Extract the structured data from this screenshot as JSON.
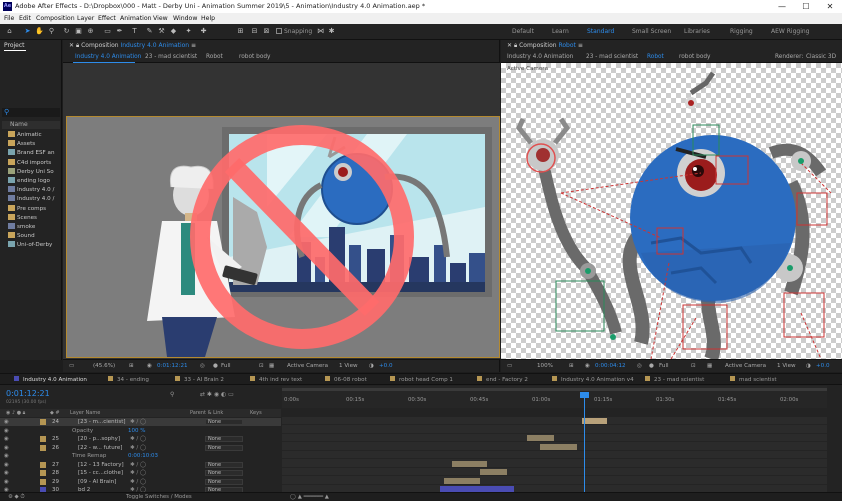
{
  "titlebar": {
    "app_logo": "Ae",
    "title": "Adobe After Effects - D:\\Dropbox\\000 - Matt - Derby Uni - Animation Summer 2019\\5 - Animation\\Industry 4.0 Animation.aep *",
    "minimize": "—",
    "maximize": "☐",
    "close": "✕"
  },
  "menubar": [
    "File",
    "Edit",
    "Composition",
    "Layer",
    "Effect",
    "Animation",
    "View",
    "Window",
    "Help"
  ],
  "toolbar": {
    "snapping": "Snapping",
    "workspaces": [
      {
        "label": "Default",
        "active": false
      },
      {
        "label": "Learn",
        "active": false
      },
      {
        "label": "Standard",
        "active": true
      },
      {
        "label": "Small Screen",
        "active": false
      },
      {
        "label": "Libraries",
        "active": false
      },
      {
        "label": "Rigging",
        "active": false
      },
      {
        "label": "AEW Rigging",
        "active": false
      }
    ]
  },
  "project": {
    "tab": "Project",
    "search_icon": "search-icon",
    "name_header": "Name",
    "items": [
      {
        "label": "Animatic",
        "kind": "folder"
      },
      {
        "label": "Assets",
        "kind": "folder"
      },
      {
        "label": "Brand ESF an",
        "kind": "img"
      },
      {
        "label": "C4d imports",
        "kind": "folder"
      },
      {
        "label": "Derby Uni So",
        "kind": "aud"
      },
      {
        "label": "ending logo",
        "kind": "img"
      },
      {
        "label": "Industry 4.0 /",
        "kind": "comp"
      },
      {
        "label": "Industry 4.0 /",
        "kind": "comp"
      },
      {
        "label": "Pre comps",
        "kind": "folder"
      },
      {
        "label": "Scenes",
        "kind": "folder"
      },
      {
        "label": "smoke",
        "kind": "comp"
      },
      {
        "label": "Sound",
        "kind": "folder"
      },
      {
        "label": "Uni-of-Derby",
        "kind": "img"
      }
    ]
  },
  "viewer_left": {
    "tab_prefix": "Composition",
    "tab_name": "Industry 4.0 Animation",
    "crumbs": [
      "Industry 4.0 Animation",
      "23 - mad scientist",
      "Robot",
      "robot body"
    ],
    "zoom": "(45.6%)",
    "timecode": "0:01:12:21",
    "quality": "Full",
    "camera": "Active Camera",
    "views": "1 View",
    "exposure": "+0.0"
  },
  "viewer_right": {
    "tab_prefix": "Composition",
    "tab_name": "Robot",
    "crumbs": [
      "Industry 4.0 Animation",
      "23 - mad scientist",
      "Robot",
      "robot body"
    ],
    "renderer_label": "Renderer:",
    "renderer": "Classic 3D",
    "active_camera": "Active Camera",
    "zoom": "100%",
    "timecode": "0:00:04:12",
    "quality": "Full",
    "camera": "Active Camera",
    "views": "1 View",
    "exposure": "+0.0"
  },
  "timeline": {
    "tabs": [
      {
        "label": "Industry 4.0 Animation",
        "active": true
      },
      {
        "label": "34 - ending",
        "active": false
      },
      {
        "label": "33 - AI Brain 2",
        "active": false
      },
      {
        "label": "4th ind rev text",
        "active": false
      },
      {
        "label": "06-08 robot",
        "active": false
      },
      {
        "label": "robot head Comp 1",
        "active": false
      },
      {
        "label": "end - Factory 2",
        "active": false
      },
      {
        "label": "Industry 4.0 Animation v4",
        "active": false
      },
      {
        "label": "23 - mad scientist",
        "active": false
      },
      {
        "label": "mad scientist",
        "active": false
      }
    ],
    "timecode": "0:01:12:21",
    "timecode_sub": "02195 (30.00 fps)",
    "ruler": [
      "0:00s",
      "00:15s",
      "00:30s",
      "00:45s",
      "01:00s",
      "01:15s",
      "01:30s",
      "01:45s",
      "02:00s"
    ],
    "columns": {
      "layer_name": "Layer Name",
      "parent": "Parent & Link",
      "keys": "Keys"
    },
    "rows": [
      {
        "num": "24",
        "name": "[23 - m...cientist]",
        "mode": "None",
        "color": "#b59653",
        "selected": true
      },
      {
        "num": "",
        "name": "Opacity",
        "value": "100 %",
        "mode": "",
        "color": "",
        "sub": true
      },
      {
        "num": "25",
        "name": "[20 - p...sophy]",
        "mode": "None",
        "color": "#b59653"
      },
      {
        "num": "26",
        "name": "[22 - w... future]",
        "mode": "None",
        "color": "#b59653"
      },
      {
        "num": "",
        "name": "Time Remap",
        "value": "0:00:10:03",
        "mode": "",
        "color": "",
        "sub": true
      },
      {
        "num": "27",
        "name": "[12 - 13 Factory]",
        "mode": "None",
        "color": "#b59653"
      },
      {
        "num": "28",
        "name": "[15 - cc...clothe]",
        "mode": "None",
        "color": "#b59653"
      },
      {
        "num": "29",
        "name": "[09 - AI Brain]",
        "mode": "None",
        "color": "#b59653"
      },
      {
        "num": "30",
        "name": "bd 2",
        "mode": "None",
        "color": "#4a4cb3"
      }
    ],
    "footer": "Toggle Switches / Modes"
  }
}
